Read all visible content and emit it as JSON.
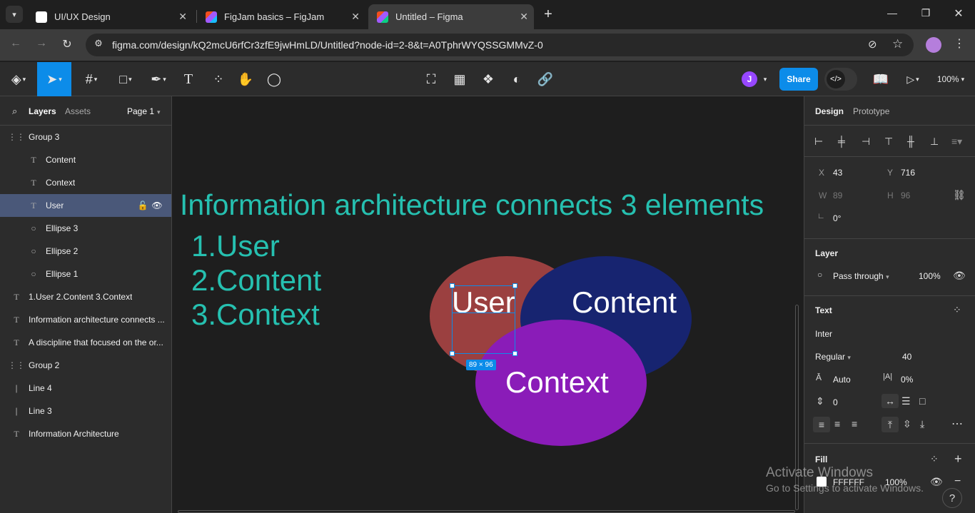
{
  "browser": {
    "tabs": [
      {
        "title": "UI/UX Design",
        "favicon_color": "#ffffff"
      },
      {
        "title": "FigJam basics – FigJam",
        "favicon_color": "#a259ff"
      },
      {
        "title": "Untitled – Figma",
        "favicon_color": "#f24e1e"
      }
    ],
    "url": "figma.com/design/kQ2mcU6rfCr3zfE9jwHmLD/Untitled?node-id=2-8&t=A0TphrWYQSSGMMvZ-0"
  },
  "toolbar": {
    "share_label": "Share",
    "avatar_initial": "J",
    "zoom": "100%",
    "accent": "#0c8ce9"
  },
  "left_panel": {
    "tabs": [
      "Layers",
      "Assets"
    ],
    "page": "Page 1",
    "layers": [
      {
        "name": "Group 3",
        "icon": "frame-dashed-icon",
        "indent": 0
      },
      {
        "name": "Content",
        "icon": "text-icon",
        "indent": 1
      },
      {
        "name": "Context",
        "icon": "text-icon",
        "indent": 1
      },
      {
        "name": "User",
        "icon": "text-icon",
        "indent": 1,
        "selected": true
      },
      {
        "name": "Ellipse 3",
        "icon": "ellipse-icon",
        "indent": 1
      },
      {
        "name": "Ellipse 2",
        "icon": "ellipse-icon",
        "indent": 1
      },
      {
        "name": "Ellipse 1",
        "icon": "ellipse-icon",
        "indent": 1
      },
      {
        "name": "1.User 2.Content 3.Context",
        "icon": "text-icon",
        "indent": 0
      },
      {
        "name": "Information architecture connects ...",
        "icon": "text-icon",
        "indent": 0
      },
      {
        "name": "A discipline that focused on the or...",
        "icon": "text-icon",
        "indent": 0
      },
      {
        "name": "Group 2",
        "icon": "frame-dashed-icon",
        "indent": 0
      },
      {
        "name": "Line 4",
        "icon": "line-icon",
        "indent": 0
      },
      {
        "name": "Line 3",
        "icon": "line-icon",
        "indent": 0
      },
      {
        "name": "Information Architecture",
        "icon": "text-icon",
        "indent": 0
      }
    ]
  },
  "canvas": {
    "heading": "Information architecture connects 3 elements",
    "list": [
      "1.User",
      "2.Content",
      "3.Context"
    ],
    "venn": {
      "user": {
        "label": "User",
        "color": "#9b4040"
      },
      "content": {
        "label": "Content",
        "color": "#172470"
      },
      "context": {
        "label": "Context",
        "color": "#8a1cb8"
      }
    },
    "selection_size": "89 × 96",
    "text_color": "#26c0b0"
  },
  "right_panel": {
    "tabs": [
      "Design",
      "Prototype"
    ],
    "x_label": "X",
    "x": "43",
    "y_label": "Y",
    "y": "716",
    "w_label": "W",
    "w": "89",
    "h_label": "H",
    "h": "96",
    "rotation": "0°",
    "layer_title": "Layer",
    "blend": "Pass through",
    "opacity": "100%",
    "text_title": "Text",
    "font": "Inter",
    "weight": "Regular",
    "size": "40",
    "line_height": "Auto",
    "letter_spacing": "0%",
    "para_spacing": "0",
    "fill_title": "Fill",
    "fill_hex": "FFFFFF",
    "fill_opacity": "100%"
  },
  "watermark": {
    "title": "Activate Windows",
    "subtitle": "Go to Settings to activate Windows."
  }
}
